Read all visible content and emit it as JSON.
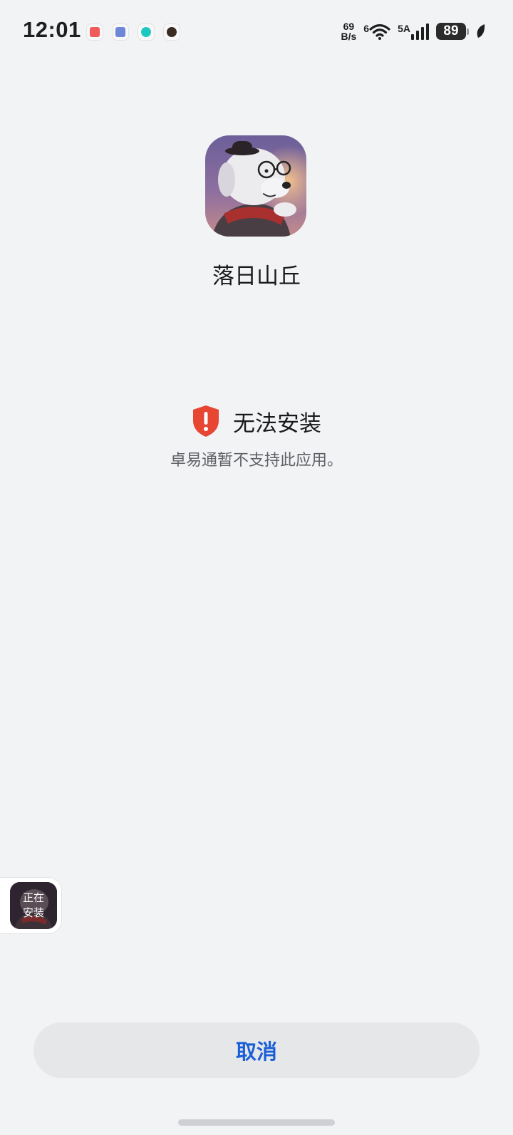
{
  "status_bar": {
    "time": "12:01",
    "net_speed_value": "69",
    "net_speed_unit": "B/s",
    "wifi_label": "6",
    "signal_label": "5A",
    "battery_level": "89",
    "notification_icons": [
      "app-red-icon",
      "app-blue-icon",
      "taptap-icon",
      "game-icon"
    ]
  },
  "app": {
    "name": "落日山丘"
  },
  "error": {
    "title": "无法安装",
    "description": "卓易通暂不支持此应用。",
    "icon_color": "#e64632"
  },
  "floating_widget": {
    "line1": "正在",
    "line2": "安装"
  },
  "actions": {
    "cancel_label": "取消",
    "accent_color": "#1a5fd6"
  }
}
